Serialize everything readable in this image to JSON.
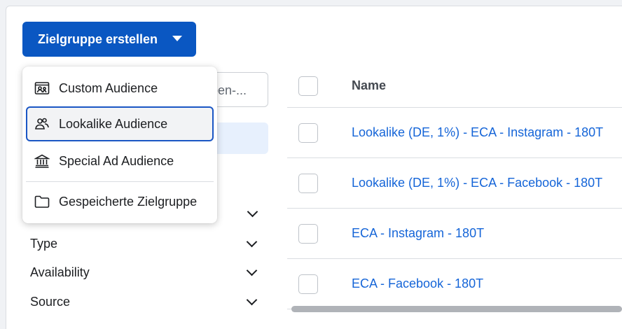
{
  "create_button": {
    "label": "Zielgruppe erstellen"
  },
  "dropdown": {
    "items": [
      {
        "label": "Custom Audience",
        "icon": "custom-audience-icon"
      },
      {
        "label": "Lookalike Audience",
        "icon": "lookalike-audience-icon",
        "selected": true
      },
      {
        "label": "Special Ad Audience",
        "icon": "special-ad-audience-icon"
      },
      {
        "label": "Gespeicherte Zielgruppe",
        "icon": "folder-icon"
      }
    ]
  },
  "search": {
    "visible_text": "ppen-..."
  },
  "filters": [
    {
      "label": "Type"
    },
    {
      "label": "Availability"
    },
    {
      "label": "Source"
    }
  ],
  "table": {
    "header": {
      "name": "Name"
    },
    "rows": [
      {
        "name": "Lookalike (DE, 1%) - ECA - Instagram - 180T"
      },
      {
        "name": "Lookalike (DE, 1%) - ECA - Facebook - 180T"
      },
      {
        "name": "ECA - Instagram - 180T"
      },
      {
        "name": "ECA - Facebook - 180T"
      }
    ]
  },
  "colors": {
    "primary": "#0a57c2",
    "link": "#1565d8",
    "focus_border": "#1a56c4"
  }
}
